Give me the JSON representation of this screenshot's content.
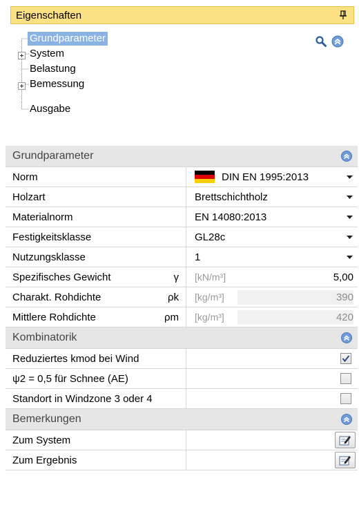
{
  "panel": {
    "title": "Eigenschaften"
  },
  "tree": {
    "items": [
      {
        "label": "Grundparameter"
      },
      {
        "label": "System"
      },
      {
        "label": "Belastung"
      },
      {
        "label": "Bemessung"
      },
      {
        "label": "Ausgabe"
      }
    ]
  },
  "sections": {
    "grundparameter": {
      "title": "Grundparameter",
      "rows": {
        "norm": {
          "name": "Norm",
          "value": "DIN EN 1995:2013"
        },
        "holzart": {
          "name": "Holzart",
          "value": "Brettschichtholz"
        },
        "materialnorm": {
          "name": "Materialnorm",
          "value": "EN 14080:2013"
        },
        "festigkeit": {
          "name": "Festigkeitsklasse",
          "value": "GL28c"
        },
        "nutzung": {
          "name": "Nutzungsklasse",
          "value": "1"
        },
        "gewicht": {
          "name": "Spezifisches Gewicht",
          "symbol": "γ",
          "unit": "[kN/m³]",
          "value": "5,00"
        },
        "rohdichte_k": {
          "name": "Charakt. Rohdichte",
          "symbol": "ρk",
          "unit": "[kg/m³]",
          "value": "390"
        },
        "rohdichte_m": {
          "name": "Mittlere Rohdichte",
          "symbol": "ρm",
          "unit": "[kg/m³]",
          "value": "420"
        }
      }
    },
    "kombinatorik": {
      "title": "Kombinatorik",
      "rows": {
        "kmod": {
          "name": "Reduziertes kmod bei Wind",
          "checked": true
        },
        "psi2": {
          "name": "ψ2 = 0,5 für Schnee (AE)",
          "checked": false
        },
        "windzone": {
          "name": "Standort in Windzone 3 oder 4",
          "checked": false
        }
      }
    },
    "bemerkungen": {
      "title": "Bemerkungen",
      "rows": {
        "system": {
          "name": "Zum System"
        },
        "ergebnis": {
          "name": "Zum Ergebnis"
        }
      }
    }
  },
  "icons": {
    "pin": "pin-icon",
    "search": "search-icon",
    "collapse": "collapse-up-icon",
    "dropdown": "chevron-down-icon",
    "edit": "edit-note-icon",
    "flag": "german-flag-icon"
  },
  "colors": {
    "header_bg": "#fbe084",
    "selection": "#8ab3e3",
    "section_bg": "#e6e6e6",
    "accent_blue": "#5b8ed6"
  }
}
